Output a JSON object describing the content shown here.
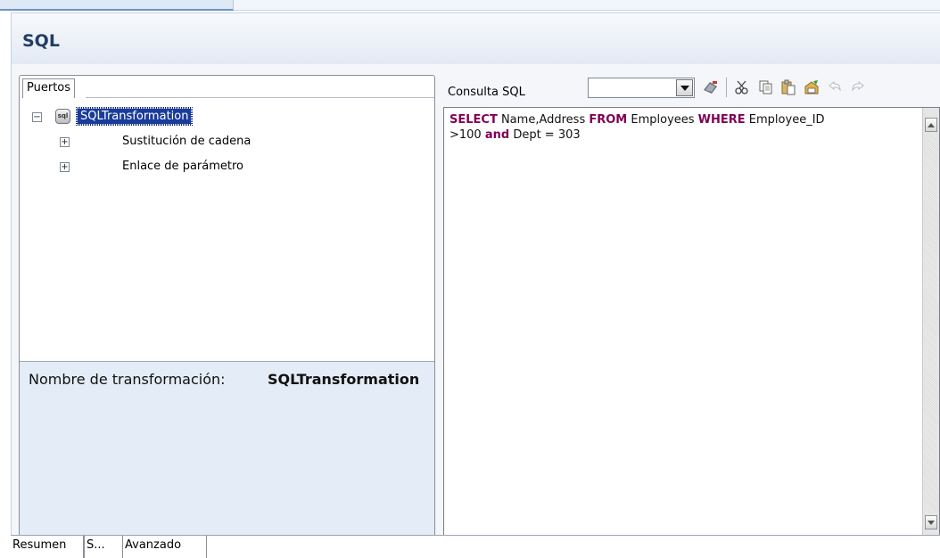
{
  "header": {
    "title": "SQL"
  },
  "ports_panel": {
    "tab_label": "Puertos",
    "tree": {
      "root": {
        "icon": "database-icon",
        "icon_text": "sql",
        "label": "SQLTransformation",
        "expander": "−"
      },
      "children": [
        {
          "label": "Sustitución de cadena",
          "expander": "+"
        },
        {
          "label": "Enlace de parámetro",
          "expander": "+"
        }
      ]
    },
    "transformation_name_label": "Nombre de transformación:",
    "transformation_name_value": "SQLTransformation"
  },
  "sql_panel": {
    "query_label": "Consulta SQL",
    "combo_value": "",
    "toolbar": [
      {
        "name": "connect-icon",
        "glyph": "⚑"
      },
      {
        "name": "cut-icon",
        "glyph": "✂"
      },
      {
        "name": "copy-icon",
        "glyph": "⎘"
      },
      {
        "name": "paste-icon",
        "glyph": "📋"
      },
      {
        "name": "clear-icon",
        "glyph": "✎"
      },
      {
        "name": "undo-icon",
        "glyph": "↶"
      },
      {
        "name": "redo-icon",
        "glyph": "↷"
      }
    ],
    "query_tokens": {
      "kw1": "SELECT",
      "t1": " Name,Address ",
      "kw2": "FROM",
      "t2": " Employees ",
      "kw3": "WHERE",
      "t3": " Employee_ID",
      "t4": ">100 ",
      "kw4": "and",
      "t5": " Dept = 303"
    }
  },
  "bottom_tabs": [
    {
      "label": "Resumen"
    },
    {
      "label": "S..."
    },
    {
      "label": "Avanzado"
    }
  ],
  "colors": {
    "keyword": "#7f0055",
    "selection": "#1a3c99",
    "name_panel_bg": "#e4ecf7"
  }
}
